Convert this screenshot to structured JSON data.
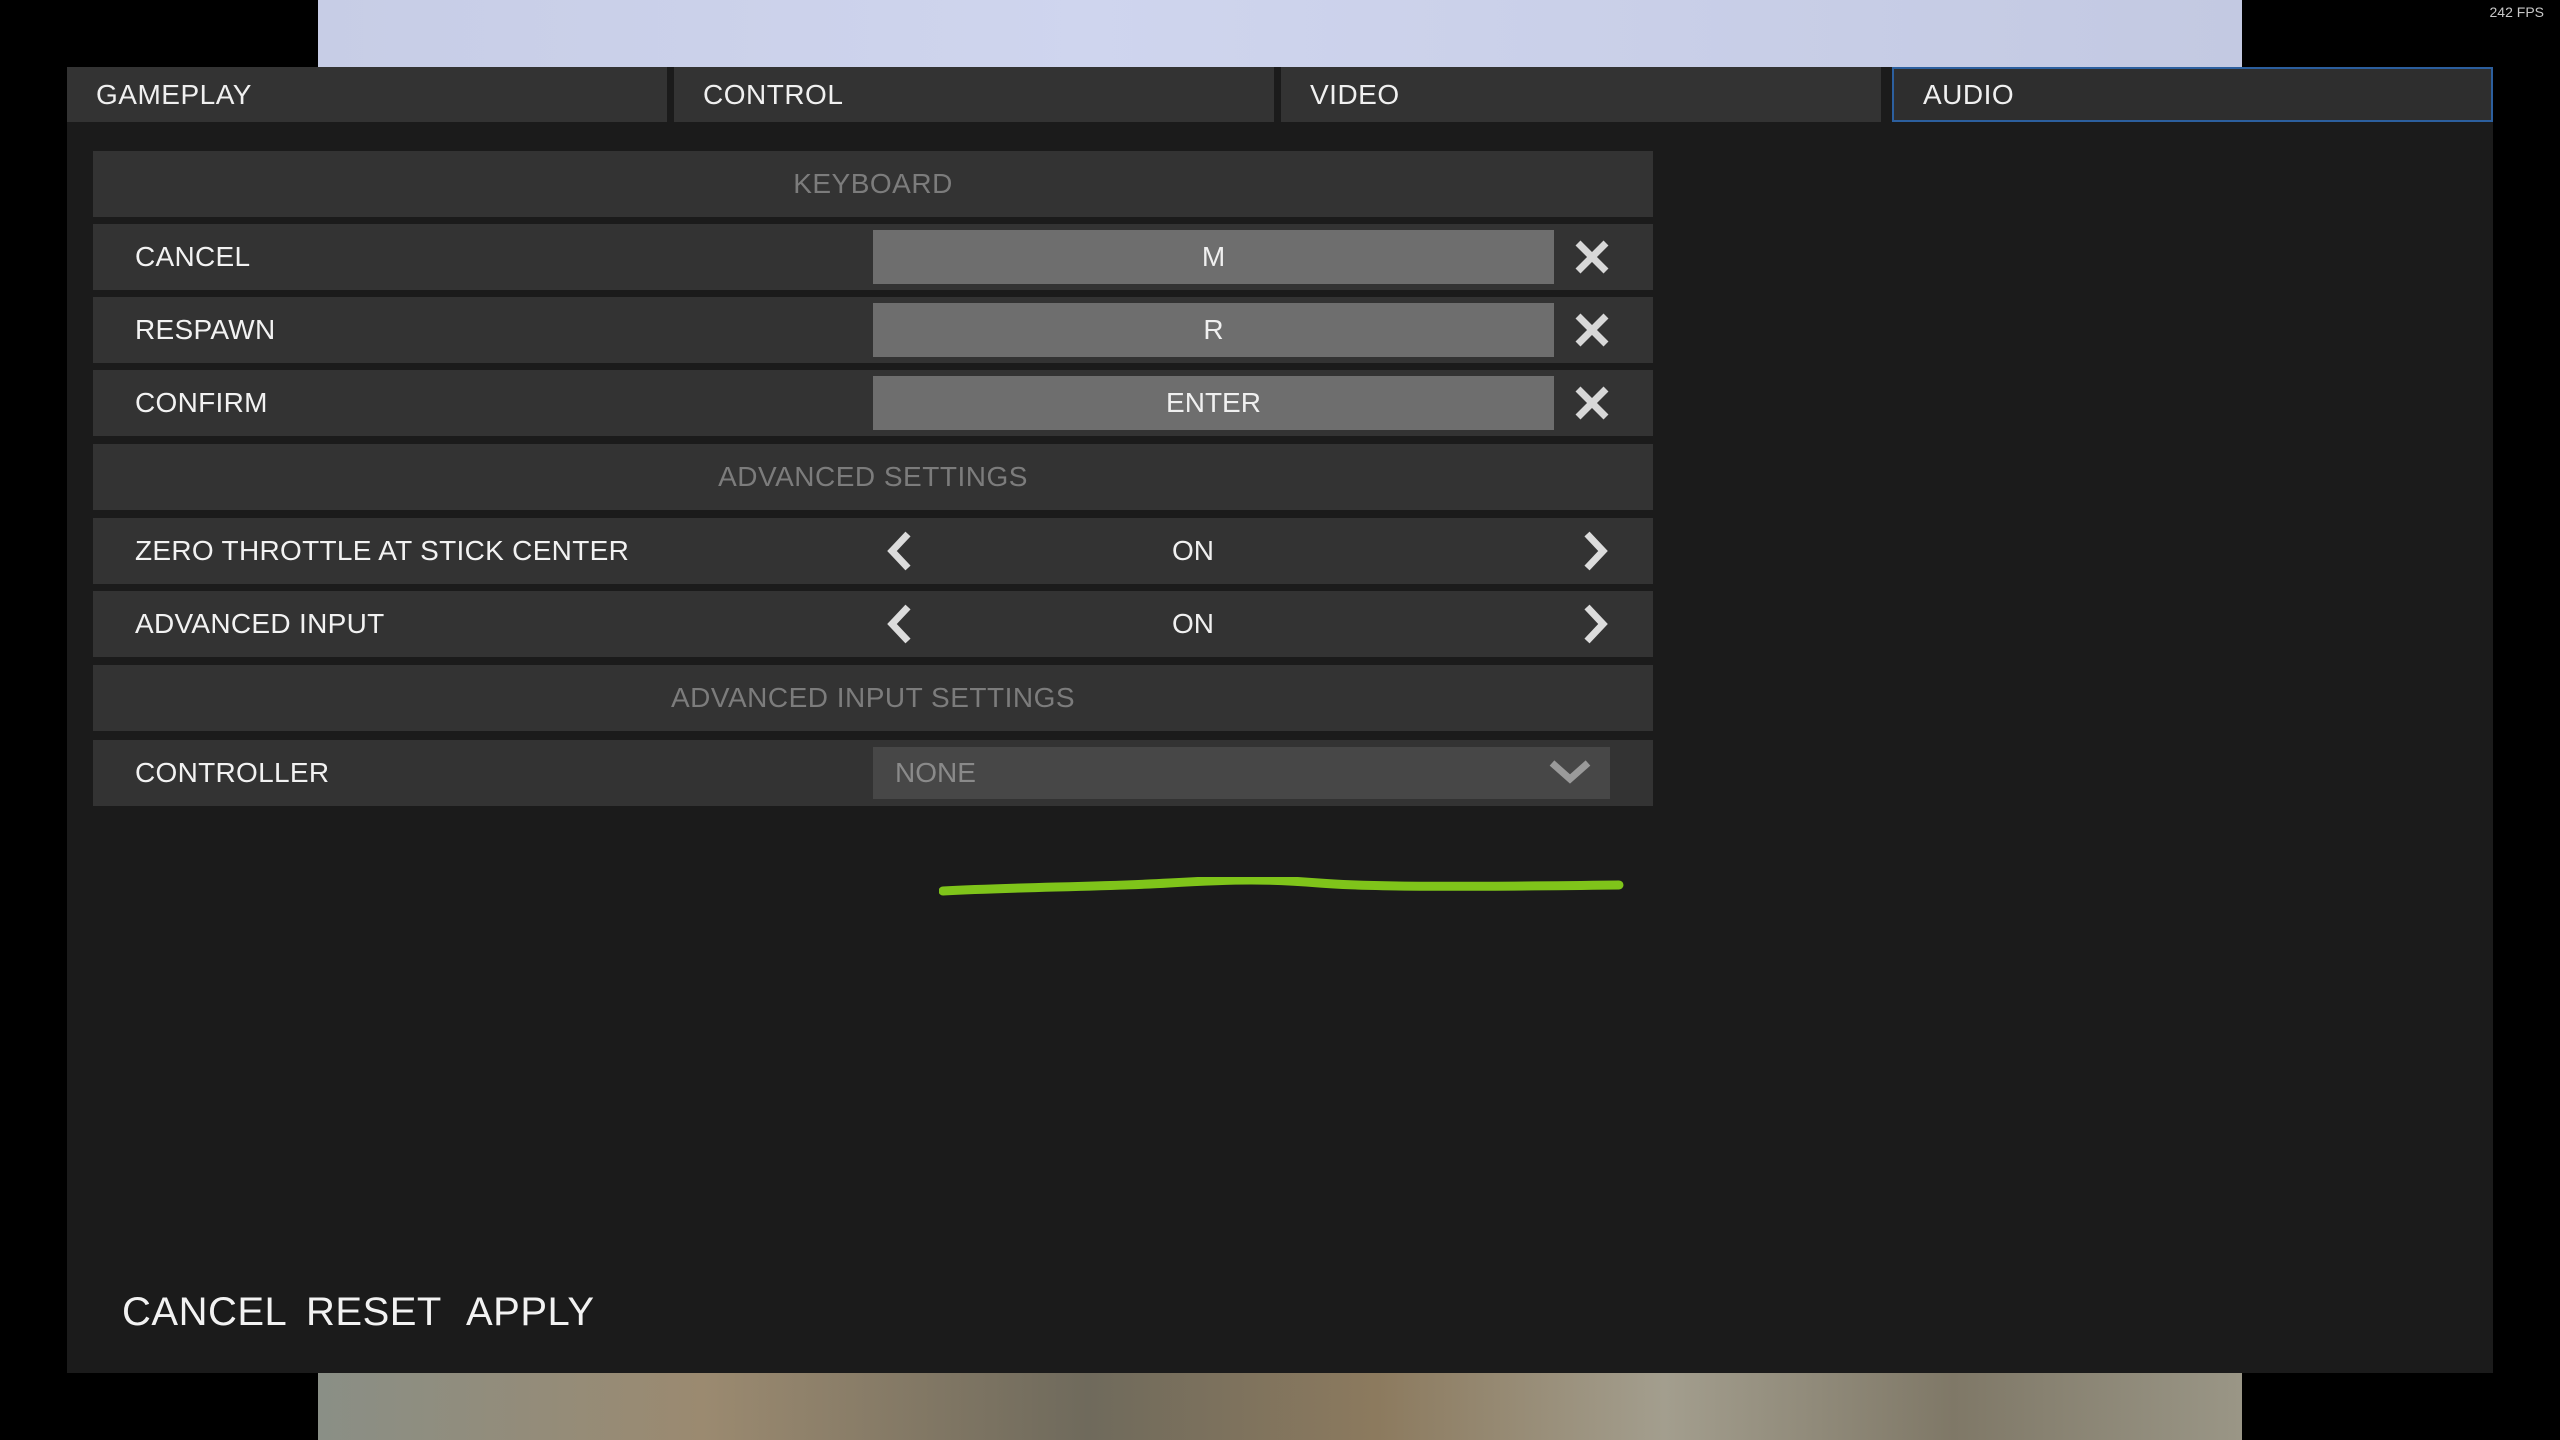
{
  "fps": "242 FPS",
  "tabs": [
    {
      "label": "GAMEPLAY",
      "active": false
    },
    {
      "label": "CONTROL",
      "active": false
    },
    {
      "label": "VIDEO",
      "active": false
    },
    {
      "label": "AUDIO",
      "active": true
    }
  ],
  "sections": {
    "keyboard": "KEYBOARD",
    "advanced_settings": "ADVANCED SETTINGS",
    "advanced_input_settings": "ADVANCED INPUT SETTINGS"
  },
  "keybinds": [
    {
      "label": "CANCEL",
      "key": "M"
    },
    {
      "label": "RESPAWN",
      "key": "R"
    },
    {
      "label": "CONFIRM",
      "key": "ENTER"
    }
  ],
  "toggles": [
    {
      "label": "ZERO THROTTLE AT STICK CENTER",
      "value": "ON"
    },
    {
      "label": "ADVANCED INPUT",
      "value": "ON"
    }
  ],
  "controller": {
    "label": "CONTROLLER",
    "value": "NONE"
  },
  "annotation_color": "#7fc41a",
  "active_tab_border": "#2c5f9e",
  "actions": {
    "cancel": "CANCEL",
    "reset": "RESET",
    "apply": "APPLY"
  }
}
